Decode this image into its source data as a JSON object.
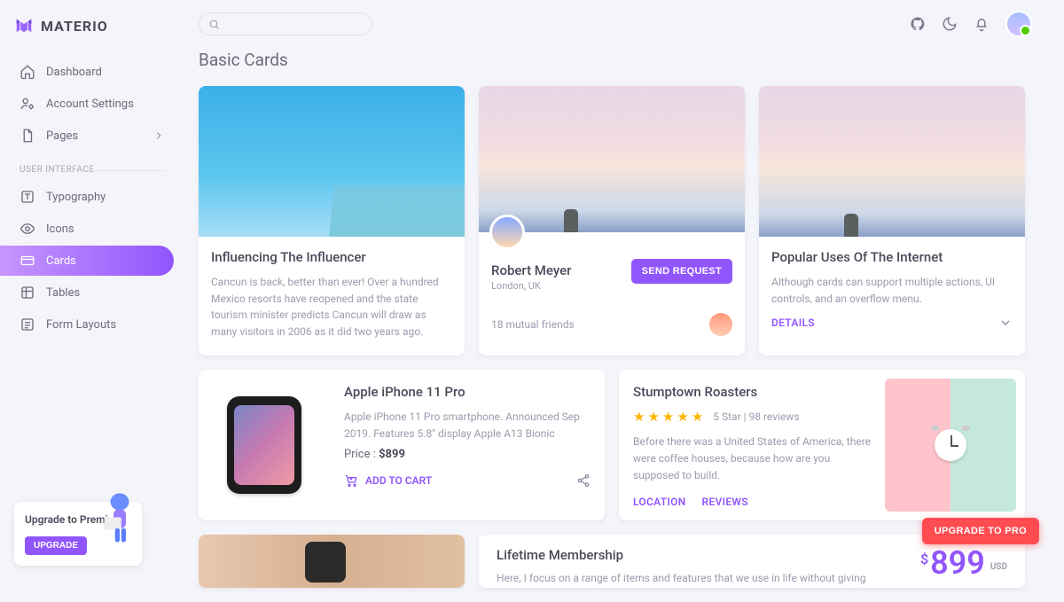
{
  "brand": {
    "name": "MATERIO"
  },
  "header": {
    "search_placeholder": ""
  },
  "sidebar": {
    "items": [
      {
        "label": "Dashboard"
      },
      {
        "label": "Account Settings"
      },
      {
        "label": "Pages"
      }
    ],
    "section_label": "USER INTERFACE",
    "ui_items": [
      {
        "label": "Typography"
      },
      {
        "label": "Icons"
      },
      {
        "label": "Cards"
      },
      {
        "label": "Tables"
      },
      {
        "label": "Form Layouts"
      }
    ]
  },
  "page": {
    "title": "Basic Cards"
  },
  "card1": {
    "title": "Influencing The Influencer",
    "text": "Cancun is back, better than ever! Over a hundred Mexico resorts have reopened and the state tourism minister predicts Cancun will draw as many visitors in 2006 as it did two years ago."
  },
  "card2": {
    "name": "Robert Meyer",
    "location": "London, UK",
    "button": "SEND REQUEST",
    "mutual": "18 mutual friends"
  },
  "card3": {
    "title": "Popular Uses Of The Internet",
    "text": "Although cards can support multiple actions, UI controls, and an overflow menu.",
    "details": "DETAILS"
  },
  "card4": {
    "title": "Apple iPhone 11 Pro",
    "text": "Apple iPhone 11 Pro smartphone. Announced Sep 2019. Features 5.8\" display Apple A13 Bionic",
    "price_label": "Price : ",
    "price": "$899",
    "add": "ADD TO CART"
  },
  "card5": {
    "title": "Stumptown Roasters",
    "rating_text": "5 Star | 98 reviews",
    "text": "Before there was a United States of America, there were coffee houses, because how are you supposed to build.",
    "location": "LOCATION",
    "reviews": "REVIEWS"
  },
  "card7": {
    "title": "Lifetime Membership",
    "text": "Here, I focus on a range of items and features that we use in life without giving",
    "price": "899",
    "currency": "$",
    "unit": "USD"
  },
  "upgrade": {
    "title": "Upgrade to Premium",
    "button": "UPGRADE"
  },
  "float_button": "UPGRADE TO PRO"
}
